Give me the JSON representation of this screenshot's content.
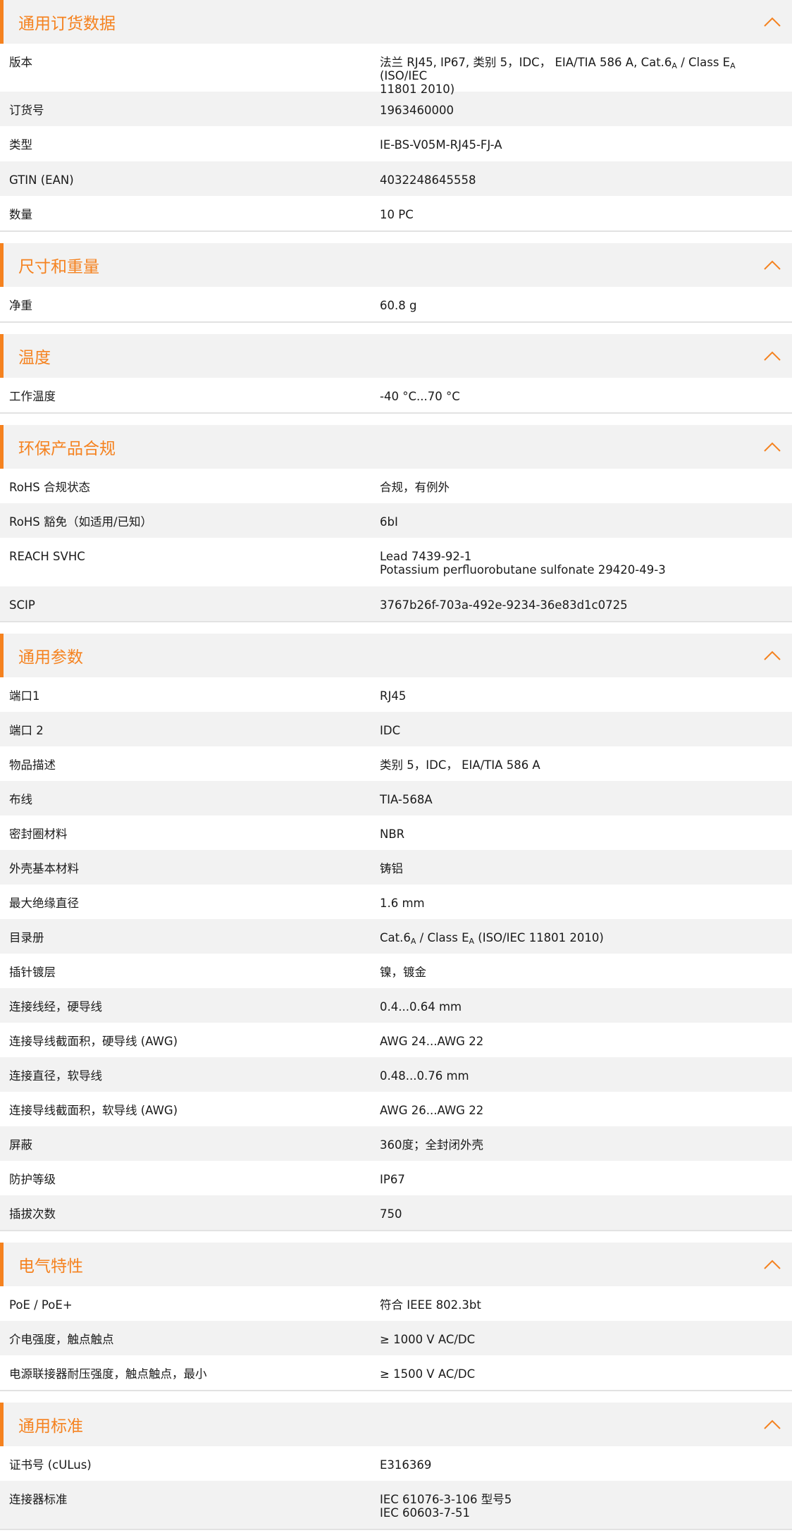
{
  "accent_color": "#f5821f",
  "chevron_icon": "chevron-up-icon",
  "sections": [
    {
      "title": "通用订货数据",
      "rows": [
        {
          "label": "版本",
          "value": [
            "法兰 RJ45, IP67, 类别 5，IDC， EIA/TIA 586 A, Cat.6A / Class EA (ISO/IEC",
            "11801 2010)"
          ]
        },
        {
          "label": "订货号",
          "value": [
            "1963460000"
          ]
        },
        {
          "label": "类型",
          "value": [
            "IE-BS-V05M-RJ45-FJ-A"
          ]
        },
        {
          "label": "GTIN (EAN)",
          "value": [
            "4032248645558"
          ]
        },
        {
          "label": "数量",
          "value": [
            "10  PC"
          ]
        }
      ]
    },
    {
      "title": "尺寸和重量",
      "rows": [
        {
          "label": "净重",
          "value": [
            "60.8  g"
          ]
        }
      ]
    },
    {
      "title": "温度",
      "rows": [
        {
          "label": "工作温度",
          "value": [
            "-40 °C...70 °C"
          ]
        }
      ]
    },
    {
      "title": "环保产品合规",
      "rows": [
        {
          "label": "RoHS 合规状态",
          "value": [
            "合规，有例外"
          ]
        },
        {
          "label": "RoHS 豁免（如适用/已知）",
          "value": [
            "6bI"
          ]
        },
        {
          "label": "REACH SVHC",
          "value": [
            "Lead 7439-92-1",
            "Potassium perfluorobutane sulfonate 29420-49-3"
          ]
        },
        {
          "label": "SCIP",
          "value": [
            "3767b26f-703a-492e-9234-36e83d1c0725"
          ]
        }
      ]
    },
    {
      "title": "通用参数",
      "rows": [
        {
          "label": "端口1",
          "value": [
            "RJ45"
          ]
        },
        {
          "label": "端口 2",
          "value": [
            "IDC"
          ]
        },
        {
          "label": "物品描述",
          "value": [
            "类别 5，IDC， EIA/TIA 586 A"
          ]
        },
        {
          "label": "布线",
          "value": [
            "TIA-568A"
          ]
        },
        {
          "label": "密封圈材料",
          "value": [
            "NBR"
          ]
        },
        {
          "label": "外壳基本材料",
          "value": [
            "铸铝"
          ]
        },
        {
          "label": "最大绝缘直径",
          "value": [
            "1.6  mm"
          ]
        },
        {
          "label": "目录册",
          "value": [
            "Cat.6A / Class EA (ISO/IEC 11801 2010)"
          ]
        },
        {
          "label": "插针镀层",
          "value": [
            "镍，镀金"
          ]
        },
        {
          "label": "连接线经，硬导线",
          "value": [
            "0.4...0.64 mm"
          ]
        },
        {
          "label": "连接导线截面积，硬导线 (AWG)",
          "value": [
            "AWG 24...AWG 22"
          ]
        },
        {
          "label": "连接直径，软导线",
          "value": [
            "0.48...0.76 mm"
          ]
        },
        {
          "label": "连接导线截面积，软导线 (AWG)",
          "value": [
            "AWG 26...AWG 22"
          ]
        },
        {
          "label": "屏蔽",
          "value": [
            "360度；全封闭外壳"
          ]
        },
        {
          "label": "防护等级",
          "value": [
            "IP67"
          ]
        },
        {
          "label": "插拔次数",
          "value": [
            "750"
          ]
        }
      ]
    },
    {
      "title": "电气特性",
      "rows": [
        {
          "label": "PoE / PoE+",
          "value": [
            "符合 IEEE 802.3bt"
          ]
        },
        {
          "label": "介电强度，触点触点",
          "value": [
            "≥ 1000 V AC/DC"
          ]
        },
        {
          "label": "电源联接器耐压强度，触点触点，最小",
          "value": [
            "≥ 1500 V AC/DC"
          ]
        }
      ]
    },
    {
      "title": "通用标准",
      "rows": [
        {
          "label": "证书号 (cULus)",
          "value": [
            "E316369"
          ]
        },
        {
          "label": "连接器标准",
          "value": [
            "IEC 61076-3-106 型号5",
            "IEC 60603-7-51"
          ]
        }
      ]
    }
  ]
}
